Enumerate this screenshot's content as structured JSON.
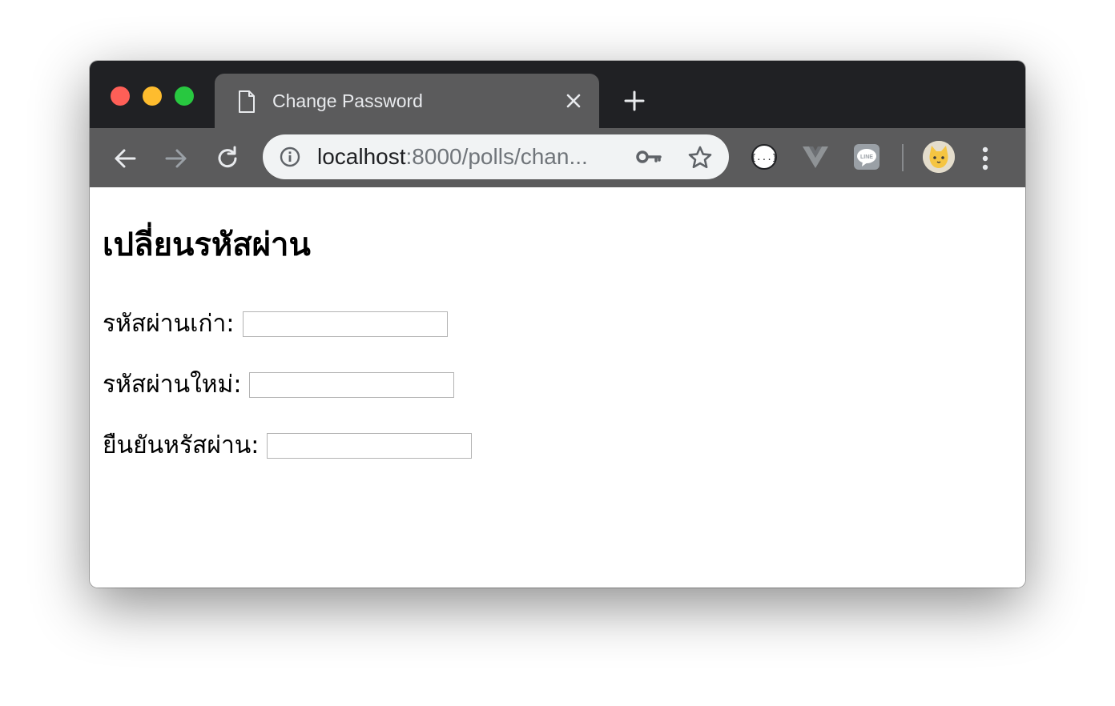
{
  "browser": {
    "tab": {
      "title": "Change Password",
      "icon": "document-icon"
    },
    "address": {
      "host": "localhost",
      "rest": ":8000/polls/chan..."
    },
    "extensions": [
      "json-viewer-icon",
      "vue-devtools-icon",
      "line-icon"
    ],
    "colors": {
      "titlebar": "#202124",
      "toolbar": "#5b5b5c",
      "omnibox": "#f1f3f4"
    }
  },
  "page": {
    "heading": "เปลี่ยนรหัสผ่าน",
    "fields": [
      {
        "label": "รหัสผ่านเก่า:",
        "value": ""
      },
      {
        "label": "รหัสผ่านใหม่:",
        "value": ""
      },
      {
        "label": "ยืนยันหรัสผ่าน:",
        "value": ""
      }
    ]
  }
}
